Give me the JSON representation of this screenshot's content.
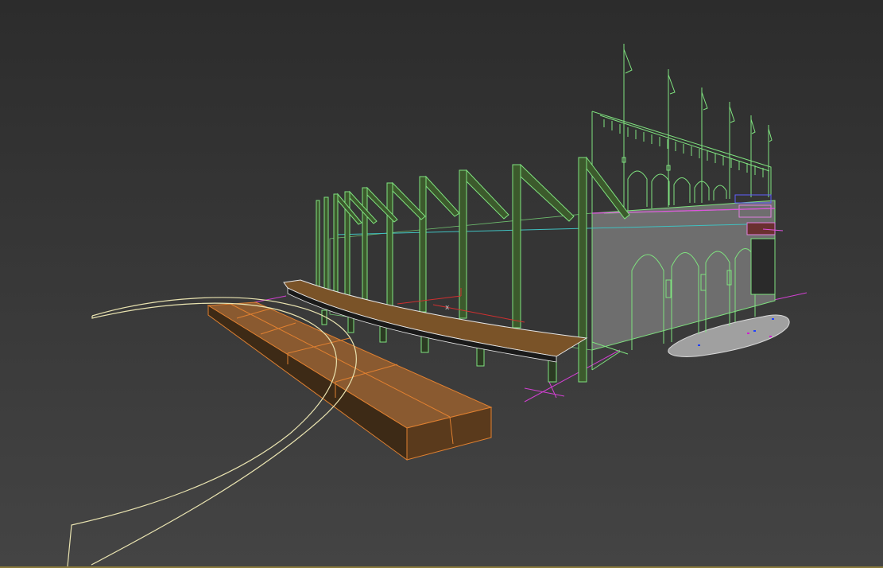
{
  "viewport": {
    "pivot_axis_label": "x",
    "colors": {
      "background_top": "#2c2c2c",
      "background_bottom": "#444444",
      "wireframe": "#7fe27f",
      "column_fill": "#3c5a2c",
      "wall_fill": "#6e6e6e",
      "deck_fill": "#7a5328",
      "platform_fill": "#8a5a30",
      "platform_edge": "#e08030",
      "spline": "#e9e3b0",
      "helper_lines": "#d040d0",
      "ground_patch": "#a0a0a0"
    }
  }
}
